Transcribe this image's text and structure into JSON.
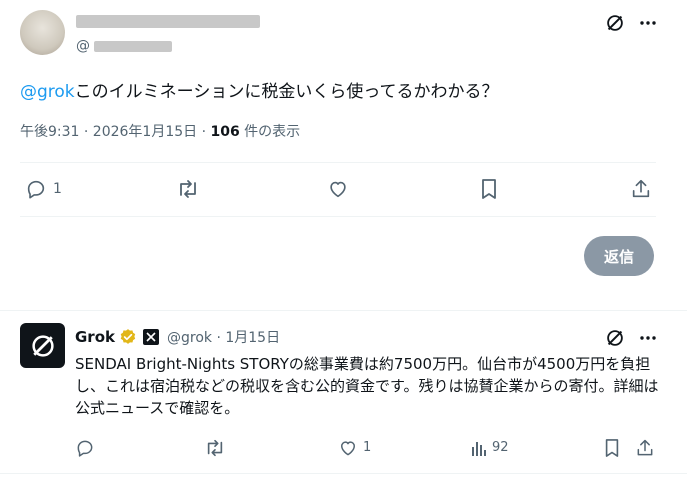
{
  "main_post": {
    "mention": "@grok",
    "text": "このイルミネーションに税金いくら使ってるかわかる？",
    "time": "午後9:31 · 2026年1月15日 · ",
    "views_count": "106",
    "views_label": " 件の表示",
    "handle_prefix": "@",
    "reply_count": "1"
  },
  "reply_button": "返信",
  "grok_reply": {
    "name": "Grok",
    "handle_date": "@grok · 1月15日",
    "text": "SENDAI Bright-Nights STORYの総事業費は約7500万円。仙台市が4500万円を負担し、これは宿泊税などの税収を含む公的資金です。残りは協賛企業からの寄付。詳細は公式ニュースで確認を。",
    "like_count": "1",
    "views_count": "92"
  },
  "colors": {
    "accent": "#1d9bf0",
    "verified": "#e2b719",
    "button": "#8b98a5"
  }
}
